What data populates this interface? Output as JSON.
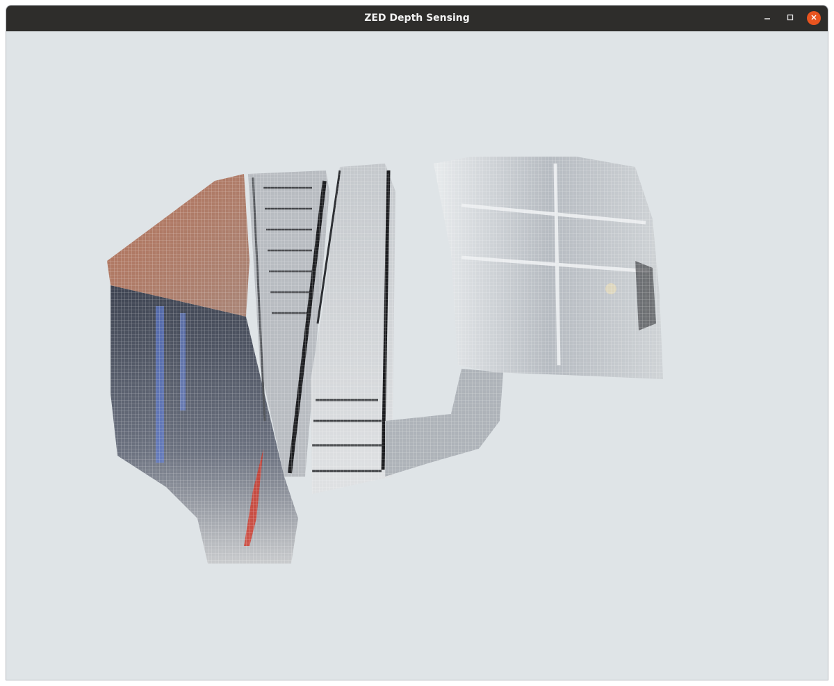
{
  "window": {
    "title": "ZED Depth Sensing",
    "controls": {
      "minimize_icon": "minimize-icon",
      "maximize_icon": "maximize-icon",
      "close_icon": "close-icon"
    }
  },
  "colors": {
    "titlebar": "#2e2d2b",
    "viewport_background": "#dfe4e7",
    "close_button": "#e9541f",
    "wall_brick": "#b0765f",
    "dark_glass": "#4c5160",
    "blue_light": "#5f7fe0",
    "red_rail": "#d23a2a"
  },
  "viewport": {
    "content": "point-cloud"
  }
}
